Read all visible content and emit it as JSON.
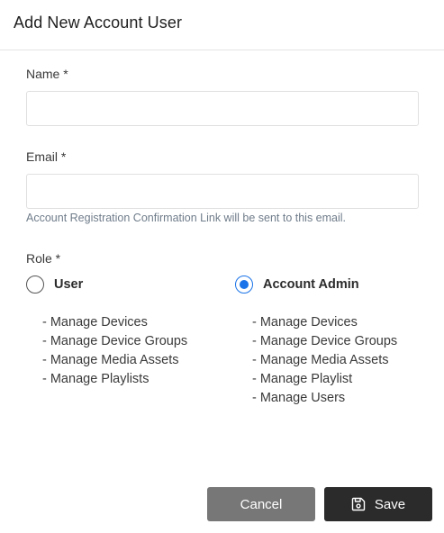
{
  "dialog": {
    "title": "Add New Account User"
  },
  "form": {
    "name": {
      "label": "Name *",
      "value": "",
      "placeholder": ""
    },
    "email": {
      "label": "Email *",
      "value": "",
      "placeholder": "",
      "hint": "Account Registration Confirmation Link will be sent to this email."
    },
    "role": {
      "label": "Role *",
      "selected": "Account Admin",
      "options": [
        {
          "label": "User",
          "checked": false,
          "permissions": [
            "- Manage Devices",
            "- Manage Device Groups",
            "- Manage Media Assets",
            "- Manage Playlists"
          ]
        },
        {
          "label": "Account Admin",
          "checked": true,
          "permissions": [
            "- Manage Devices",
            "- Manage Device Groups",
            "- Manage Media Assets",
            "- Manage Playlist",
            "- Manage Users"
          ]
        }
      ]
    }
  },
  "actions": {
    "cancel_label": "Cancel",
    "save_label": "Save",
    "save_icon": "floppy-disk-icon"
  },
  "colors": {
    "accent": "#1a73e8",
    "cancel_bg": "#777777",
    "save_bg": "#2b2b2b",
    "hint_text": "#6f7c8a"
  }
}
